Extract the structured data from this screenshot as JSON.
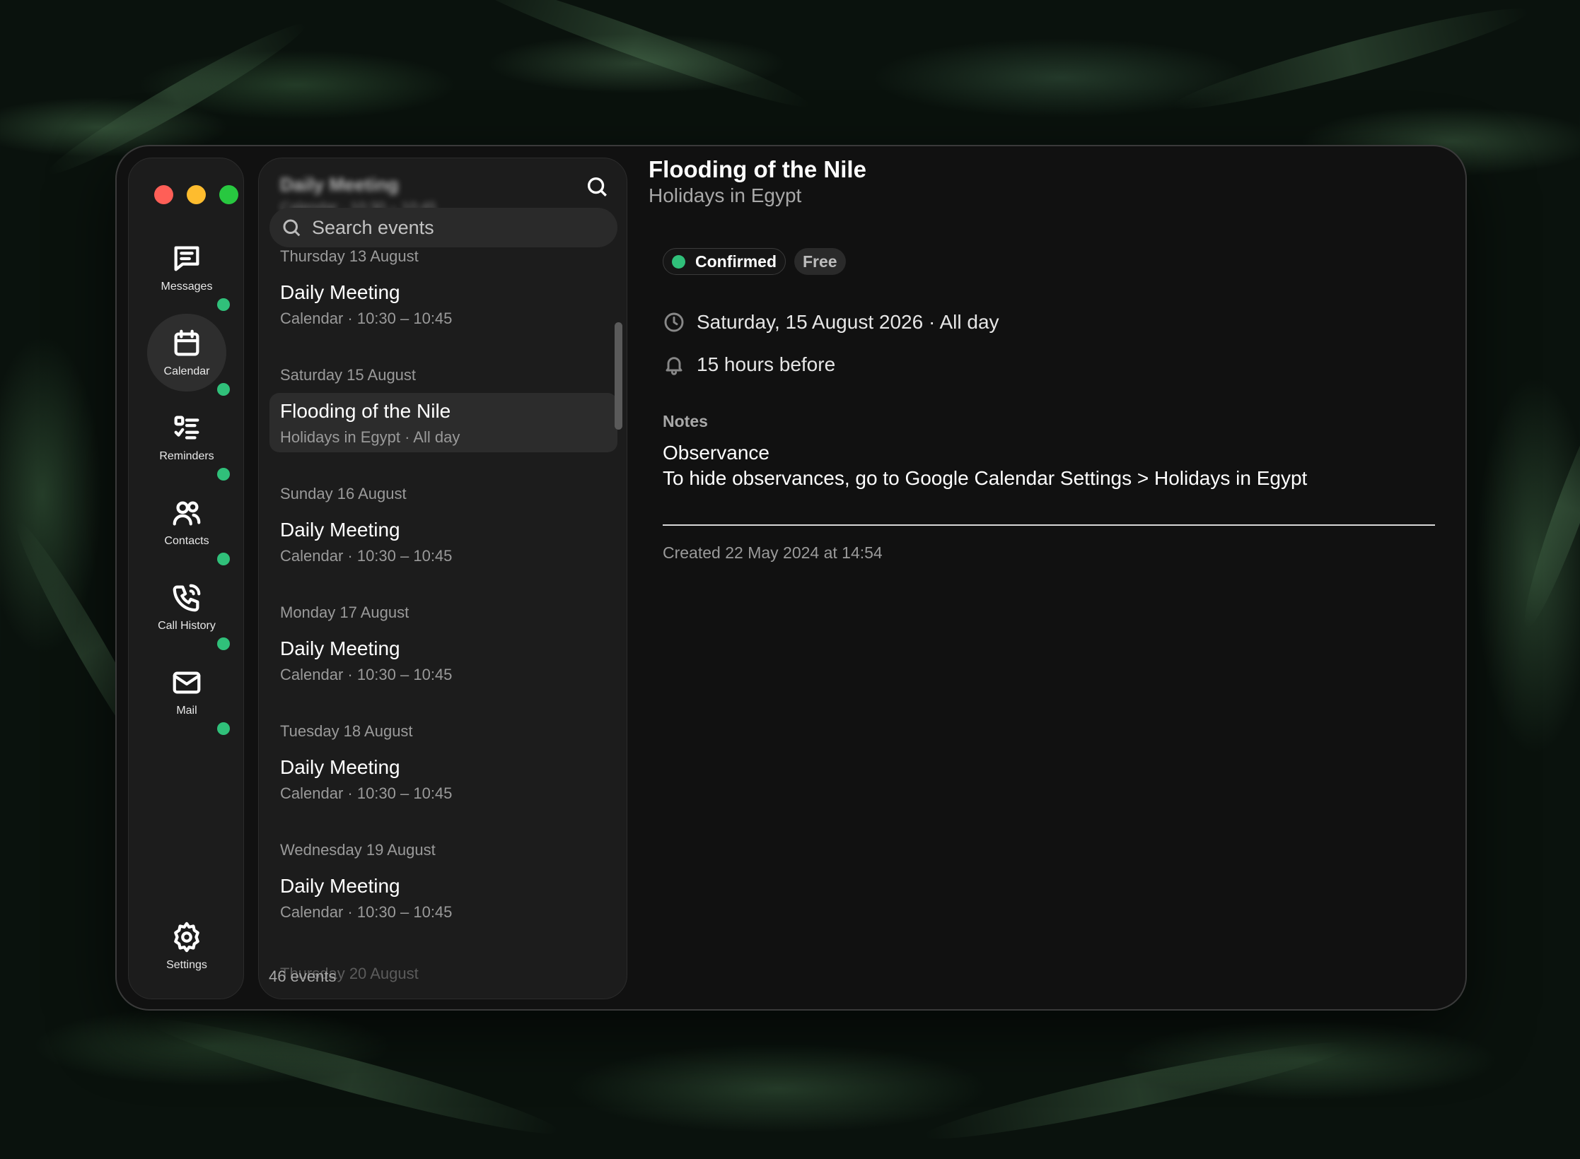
{
  "sidebar": {
    "items": [
      {
        "label": "Messages",
        "icon": "message-icon",
        "active": false
      },
      {
        "label": "Calendar",
        "icon": "calendar-icon",
        "active": true
      },
      {
        "label": "Reminders",
        "icon": "reminders-icon",
        "active": false
      },
      {
        "label": "Contacts",
        "icon": "contacts-icon",
        "active": false
      },
      {
        "label": "Call History",
        "icon": "phone-icon",
        "active": false
      },
      {
        "label": "Mail",
        "icon": "mail-icon",
        "active": false
      }
    ],
    "settings_label": "Settings",
    "status_color": "#30c07a"
  },
  "list": {
    "blurred_header_title": "Daily Meeting",
    "blurred_header_sub": "Calendar · 10:30 – 10:45",
    "search_placeholder": "Search events",
    "days": [
      {
        "label": "Thursday 13 August",
        "events": [
          {
            "title": "Daily Meeting",
            "sub": "Calendar · 10:30 – 10:45"
          }
        ]
      },
      {
        "label": "Saturday 15 August",
        "events": [
          {
            "title": "Flooding of the Nile",
            "sub": "Holidays in Egypt · All day",
            "selected": true
          }
        ]
      },
      {
        "label": "Sunday 16 August",
        "events": [
          {
            "title": "Daily Meeting",
            "sub": "Calendar · 10:30 – 10:45"
          }
        ]
      },
      {
        "label": "Monday 17 August",
        "events": [
          {
            "title": "Daily Meeting",
            "sub": "Calendar · 10:30 – 10:45"
          }
        ]
      },
      {
        "label": "Tuesday 18 August",
        "events": [
          {
            "title": "Daily Meeting",
            "sub": "Calendar · 10:30 – 10:45"
          }
        ]
      },
      {
        "label": "Wednesday 19 August",
        "events": [
          {
            "title": "Daily Meeting",
            "sub": "Calendar · 10:30 – 10:45"
          }
        ]
      }
    ],
    "partial_day": "Thursday 20 August",
    "count": "46 events"
  },
  "detail": {
    "title": "Flooding of the Nile",
    "calendar": "Holidays in Egypt",
    "status": "Confirmed",
    "availability": "Free",
    "when": "Saturday, 15 August 2026 · All day",
    "alert": "15 hours before",
    "notes_heading": "Notes",
    "notes": [
      "Observance",
      "To hide observances, go to Google Calendar Settings > Holidays in Egypt"
    ],
    "created": "Created 22 May 2024 at 14:54"
  }
}
